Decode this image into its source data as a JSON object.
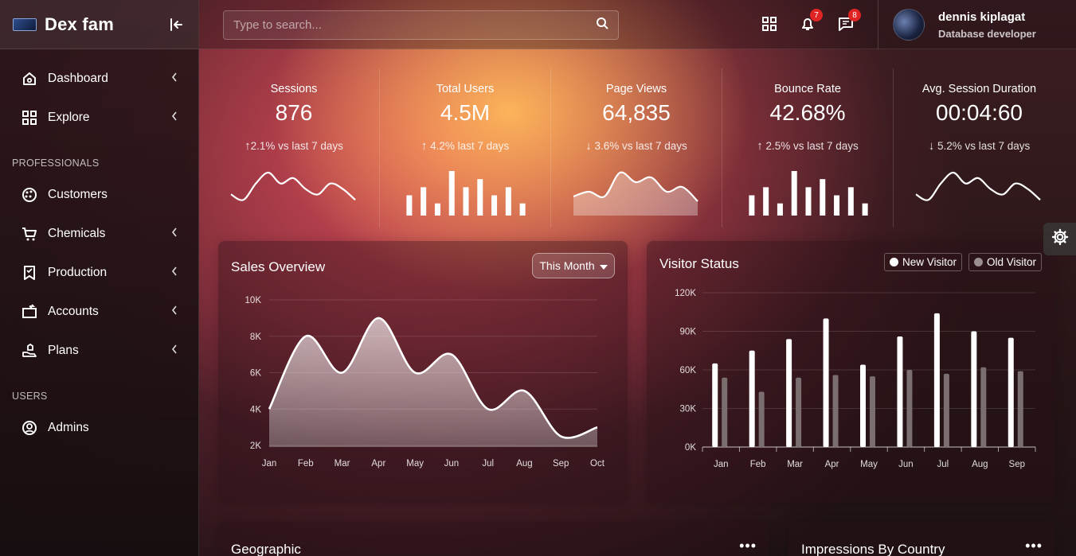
{
  "brand": {
    "name": "Dex fam"
  },
  "sidebar": {
    "items_top": [
      {
        "label": "Dashboard",
        "icon": "home-icon",
        "has_sub": true
      },
      {
        "label": "Explore",
        "icon": "grid-icon",
        "has_sub": true
      }
    ],
    "section_professionals": "PROFESSIONALS",
    "items_prof": [
      {
        "label": "Customers",
        "icon": "palette-icon",
        "has_sub": false
      },
      {
        "label": "Chemicals",
        "icon": "cart-icon",
        "has_sub": true
      },
      {
        "label": "Production",
        "icon": "bookmark-icon",
        "has_sub": true
      },
      {
        "label": "Accounts",
        "icon": "transfer-icon",
        "has_sub": true
      },
      {
        "label": "Plans",
        "icon": "hand-icon",
        "has_sub": true
      }
    ],
    "section_users": "USERS",
    "items_users": [
      {
        "label": "Admins",
        "icon": "user-circle-icon",
        "has_sub": false
      }
    ]
  },
  "header": {
    "search_placeholder": "Type to search...",
    "notifications_count": "7",
    "messages_count": "8",
    "user_name": "dennis kiplagat",
    "user_role": "Database developer"
  },
  "stats": [
    {
      "label": "Sessions",
      "value": "876",
      "direction": "up",
      "change": "2.1%",
      "suffix": "vs last 7 days",
      "spark": "line",
      "points": [
        3,
        2,
        5,
        7,
        5,
        6,
        4,
        3,
        5,
        4,
        2
      ]
    },
    {
      "label": "Total Users",
      "value": "4.5M",
      "direction": "up",
      "change": "4.2%",
      "suffix": "last 7 days",
      "spark": "bar",
      "points": [
        5,
        7,
        3,
        11,
        7,
        9,
        5,
        7,
        3
      ]
    },
    {
      "label": "Page Views",
      "value": "64,835",
      "direction": "down",
      "change": "3.6%",
      "suffix": "vs last 7 days",
      "spark": "area",
      "points": [
        3,
        4,
        3,
        8,
        6,
        7,
        4,
        5,
        2
      ]
    },
    {
      "label": "Bounce Rate",
      "value": "42.68%",
      "direction": "up",
      "change": "2.5%",
      "suffix": "vs last 7 days",
      "spark": "bar",
      "points": [
        5,
        7,
        3,
        11,
        7,
        9,
        5,
        7,
        3
      ]
    },
    {
      "label": "Avg. Session Duration",
      "value": "00:04:60",
      "direction": "down",
      "change": "5.2%",
      "suffix": "vs last 7 days",
      "spark": "line",
      "points": [
        3,
        2,
        5,
        7,
        5,
        6,
        4,
        3,
        5,
        4,
        2
      ]
    }
  ],
  "sales": {
    "title": "Sales Overview",
    "period": "This Month"
  },
  "visitors": {
    "title": "Visitor Status",
    "legend_new": "New Visitor",
    "legend_old": "Old Visitor",
    "color_new": "#ffffff",
    "color_old": "#7a6e6e"
  },
  "bottom": {
    "geographic_title": "Geographic",
    "impressions_title": "Impressions By Country",
    "more": "•••"
  },
  "chart_data": [
    {
      "type": "area",
      "categories": [
        "Jan",
        "Feb",
        "Mar",
        "Apr",
        "May",
        "Jun",
        "Jul",
        "Aug",
        "Sep",
        "Oct"
      ],
      "values": [
        4000,
        8000,
        6000,
        9000,
        6000,
        7000,
        4000,
        5000,
        2500,
        3000
      ],
      "ylim": [
        2000,
        10000
      ],
      "yticks": [
        "2K",
        "4K",
        "6K",
        "8K",
        "10K"
      ],
      "grid": true
    },
    {
      "type": "bar",
      "categories": [
        "Jan",
        "Feb",
        "Mar",
        "Apr",
        "May",
        "Jun",
        "Jul",
        "Aug",
        "Sep"
      ],
      "series": [
        {
          "name": "New Visitor",
          "values": [
            65000,
            75000,
            84000,
            100000,
            64000,
            86000,
            104000,
            90000,
            85000
          ]
        },
        {
          "name": "Old Visitor",
          "values": [
            54000,
            43000,
            54000,
            56000,
            55000,
            60000,
            57000,
            62000,
            59000
          ]
        }
      ],
      "ylim": [
        0,
        120000
      ],
      "yticks": [
        "0K",
        "30K",
        "60K",
        "90K",
        "120K"
      ],
      "legend": "top-right",
      "grid": true
    }
  ]
}
